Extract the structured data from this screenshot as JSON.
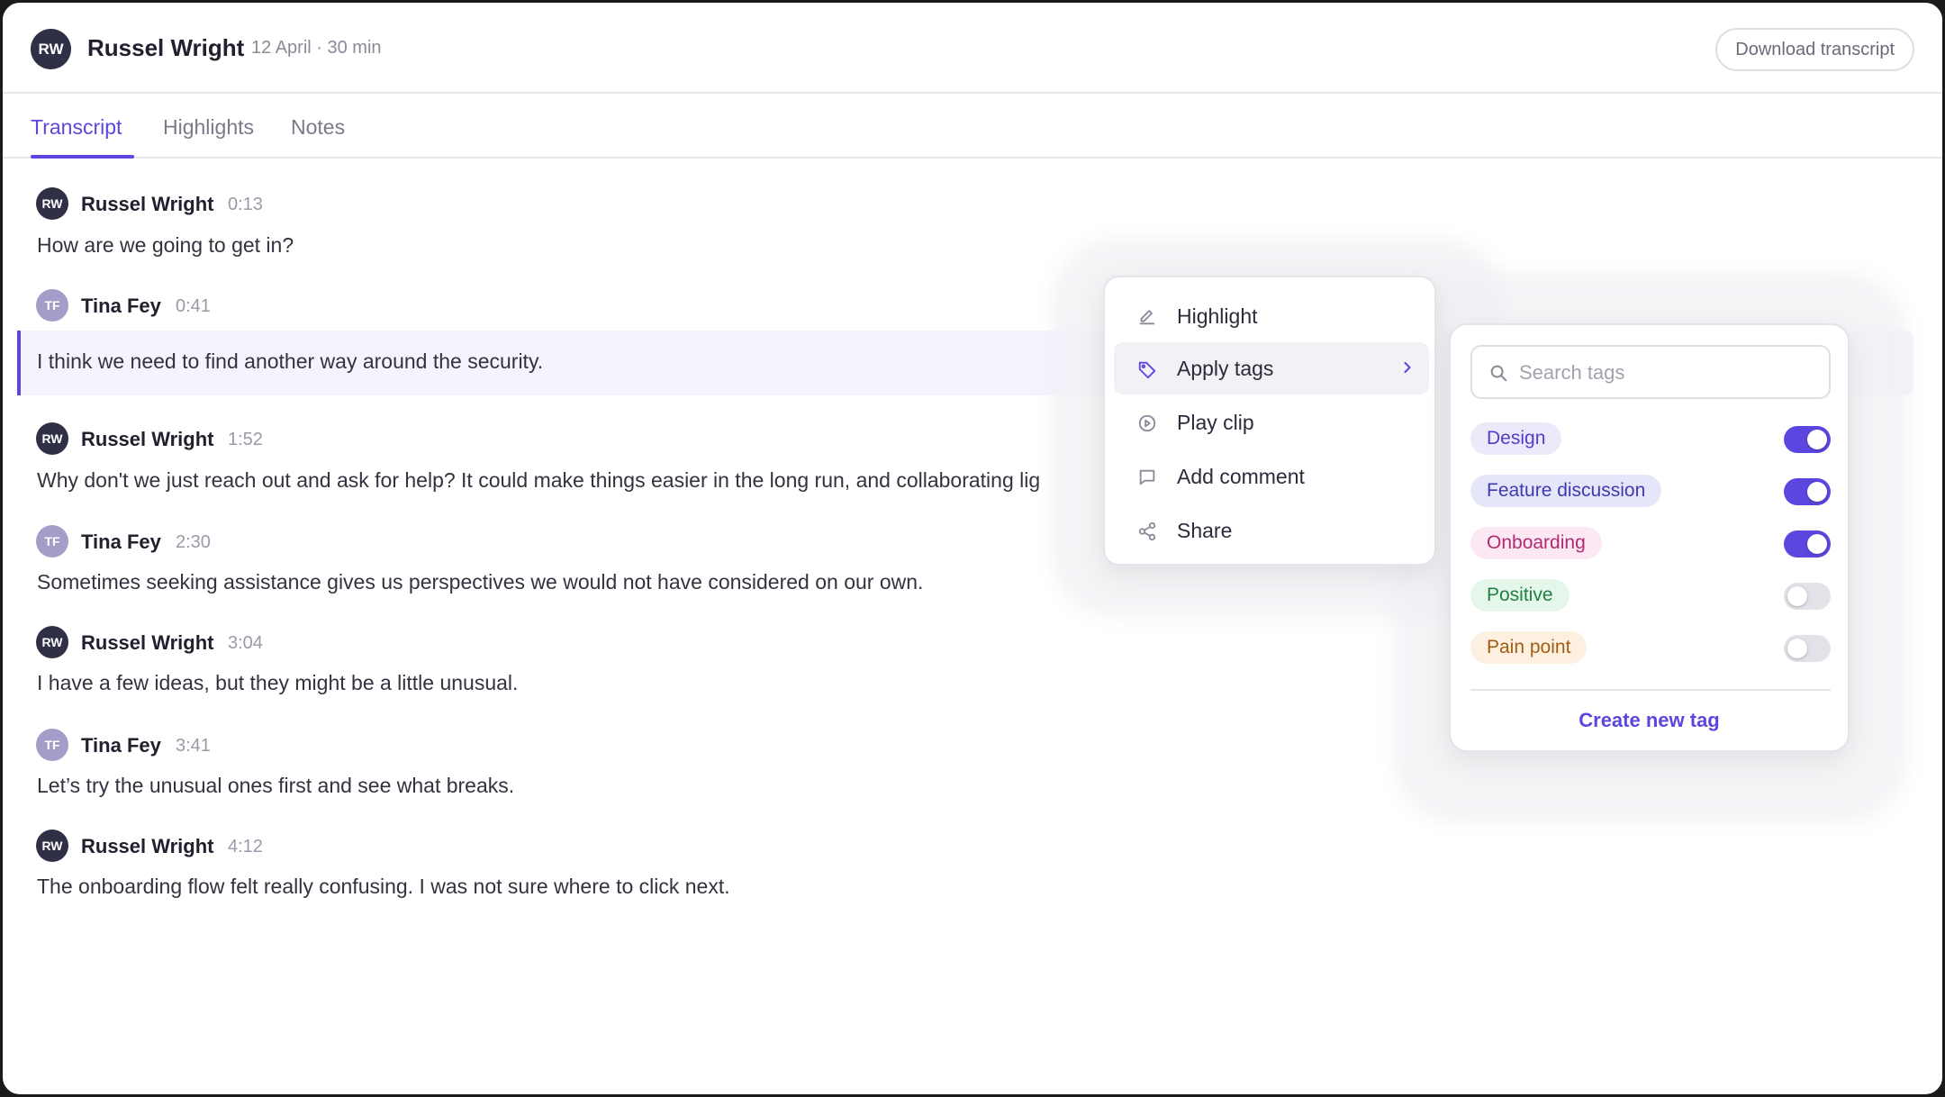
{
  "header": {
    "avatar_initials": "RW",
    "name": "Russel Wright",
    "meta": "12 April · 30 min",
    "download_label": "Download transcript"
  },
  "tabs": [
    {
      "label": "Transcript",
      "active": true
    },
    {
      "label": "Highlights",
      "active": false
    },
    {
      "label": "Notes",
      "active": false
    }
  ],
  "transcript": [
    {
      "initials": "RW",
      "speaker": "Russel Wright",
      "time": "0:13",
      "text": "How are we going to get in?"
    },
    {
      "initials": "TF",
      "speaker": "Tina Fey",
      "time": "0:41",
      "text": "I think we need to find another way around the security."
    },
    {
      "initials": "RW",
      "speaker": "Russel Wright",
      "time": "1:52",
      "text": "Why don't we just reach out and ask for help? It could make things easier in the long run, and collaborating lig"
    },
    {
      "initials": "TF",
      "speaker": "Tina Fey",
      "time": "2:30",
      "text": "Sometimes seeking assistance gives us perspectives we would not have considered on our own."
    },
    {
      "initials": "RW",
      "speaker": "Russel Wright",
      "time": "3:04",
      "text": "I have a few ideas, but they might be a little unusual."
    },
    {
      "initials": "TF",
      "speaker": "Tina Fey",
      "time": "3:41",
      "text": "Let’s try the unusual ones first and see what breaks."
    },
    {
      "initials": "RW",
      "speaker": "Russel Wright",
      "time": "4:12",
      "text": "The onboarding flow felt really confusing. I was not sure where to click next."
    }
  ],
  "context_menu": {
    "items": [
      {
        "label": "Highlight",
        "icon": "pencil-icon"
      },
      {
        "label": "Apply tags",
        "icon": "tag-icon",
        "hover": true,
        "submenu": true
      },
      {
        "label": "Play clip",
        "icon": "play-circle-icon"
      },
      {
        "label": "Add comment",
        "icon": "comment-icon"
      },
      {
        "label": "Share",
        "icon": "share-icon"
      }
    ]
  },
  "tags_panel": {
    "search_placeholder": "Search tags",
    "tags": [
      {
        "label": "Design",
        "enabled": true,
        "bg": "#ece9fb",
        "fg": "#4f3fc8"
      },
      {
        "label": "Feature discussion",
        "enabled": true,
        "bg": "#e6e6fa",
        "fg": "#3e3ab0"
      },
      {
        "label": "Onboarding",
        "enabled": true,
        "bg": "#fbe8f2",
        "fg": "#b02a72"
      },
      {
        "label": "Positive",
        "enabled": false,
        "bg": "#e5f6ea",
        "fg": "#22803f"
      },
      {
        "label": "Pain point",
        "enabled": false,
        "bg": "#fdf0e1",
        "fg": "#a25c12"
      }
    ],
    "create_label": "Create new tag"
  },
  "colors": {
    "accent": "#5b47e0",
    "dark_avatar": "#2f2f45",
    "light_avatar": "#a59cc8"
  }
}
